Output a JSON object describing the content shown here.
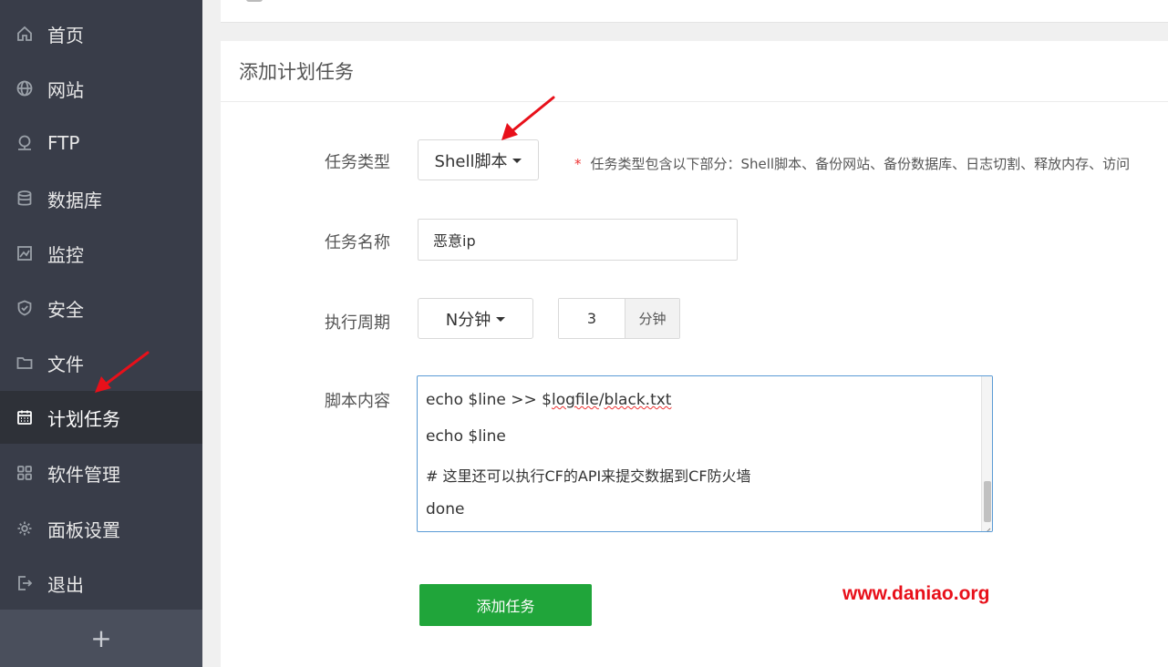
{
  "sidebar": {
    "items": [
      {
        "label": "首页",
        "icon": "home-icon"
      },
      {
        "label": "网站",
        "icon": "globe-icon"
      },
      {
        "label": "FTP",
        "icon": "ftp-icon"
      },
      {
        "label": "数据库",
        "icon": "database-icon"
      },
      {
        "label": "监控",
        "icon": "monitor-icon"
      },
      {
        "label": "安全",
        "icon": "shield-icon"
      },
      {
        "label": "文件",
        "icon": "folder-icon"
      },
      {
        "label": "计划任务",
        "icon": "calendar-icon",
        "active": true
      },
      {
        "label": "软件管理",
        "icon": "apps-icon"
      },
      {
        "label": "面板设置",
        "icon": "gear-icon"
      },
      {
        "label": "退出",
        "icon": "logout-icon"
      }
    ],
    "add_label": "+"
  },
  "card": {
    "title": "添加计划任务"
  },
  "form": {
    "task_type": {
      "label": "任务类型",
      "value": "Shell脚本",
      "hint_star": "*",
      "hint": "任务类型包含以下部分：Shell脚本、备份网站、备份数据库、日志切割、释放内存、访问"
    },
    "task_name": {
      "label": "任务名称",
      "value": "恶意ip"
    },
    "period": {
      "label": "执行周期",
      "value": "N分钟",
      "minutes": "3",
      "unit": "分钟"
    },
    "script": {
      "label": "脚本内容",
      "lines": [
        "echo $line >> $logfile/black.txt",
        "echo $line",
        "# 这里还可以执行CF的API来提交数据到CF防火墙",
        "done"
      ],
      "line0_prefix": "echo $line >> $",
      "line0_err1": "logfile",
      "line0_mid": "/",
      "line0_err2": "black.txt"
    },
    "submit_label": "添加任务"
  },
  "watermark": "www.daniao.org",
  "colors": {
    "sidebar_bg": "#393d49",
    "sidebar_active": "#2e3138",
    "primary_green": "#20a53a",
    "arrow_red": "#e8101a",
    "focus_blue": "#5b9bd5"
  }
}
